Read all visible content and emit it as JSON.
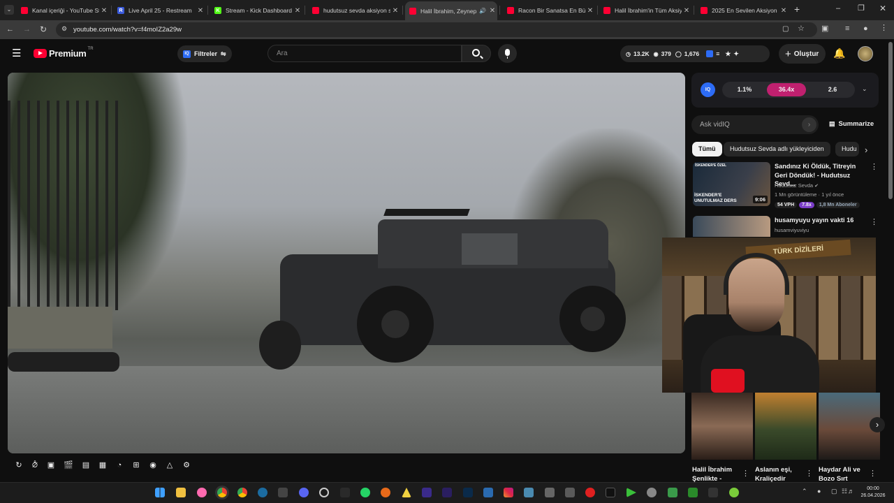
{
  "browser": {
    "tabs": [
      {
        "title": "Kanal içeriği - YouTube St",
        "fav_color": "#ff0033",
        "fav": "",
        "active": false
      },
      {
        "title": "Live April 25 - Restream",
        "fav_color": "#3b5bdb",
        "fav": "R",
        "active": false
      },
      {
        "title": "Stream - Kick Dashboard",
        "fav_color": "#53fc18",
        "fav": "K",
        "active": false
      },
      {
        "title": "hudutsuz sevda aksiyon s",
        "fav_color": "#ff0033",
        "fav": "",
        "active": false
      },
      {
        "title": "Halil İbrahim, Zeynep",
        "fav_color": "#ff0033",
        "fav": "",
        "active": true
      },
      {
        "title": "Racon Bir Sanatsa En Büy",
        "fav_color": "#ff0033",
        "fav": "",
        "active": false
      },
      {
        "title": "Halil İbrahim'in Tüm Aksiy",
        "fav_color": "#ff0033",
        "fav": "",
        "active": false
      },
      {
        "title": "2025 En Sevilen Aksiyon",
        "fav_color": "#ff0033",
        "fav": "",
        "active": false
      }
    ],
    "new_tab": "+",
    "url": "youtube.com/watch?v=f4moIZ2a29w"
  },
  "youtube": {
    "logo_text": "Premium",
    "logo_badge": "TR",
    "filters_label": "Filtreler",
    "search_placeholder": "Ara",
    "stats": {
      "a": "13.2K",
      "b": "379",
      "c": "1,676"
    },
    "create_label": "Oluştur"
  },
  "vidiq": {
    "logo": "IQ",
    "metric1": "1.1%",
    "metric2": "36.4x",
    "metric3": "2.6",
    "ask_placeholder": "Ask vidIQ",
    "summarize": "Summarize"
  },
  "chips": [
    "Tümü",
    "Hudutsuz Sevda adlı yükleyiciden",
    "Hudu"
  ],
  "recommendations": [
    {
      "title": "Sandınız Ki Öldük, Titreyin Geri Döndük! - Hudutsuz Sevd...",
      "channel": "Hudutsuz Sevda",
      "meta": "1 Mn görüntüleme · 1 yıl önce",
      "duration": "9:06",
      "thumb_text": "İSKENDER'E UNUTULMAZ DERS",
      "thumb_top": "İSKENDER'E ÖZEL",
      "vph": "54 VPH",
      "ratio": "7.8x",
      "subs": "1,8 Mn Aboneler"
    },
    {
      "title": "husamyuyu yayın vakti 16",
      "channel": "husamviyuviyu"
    }
  ],
  "shorts": [
    {
      "title": "Halil İbrahim Şenlikte -"
    },
    {
      "title": "Aslanın eşi, Kraliçedir"
    },
    {
      "title": "Haydar Ali ve Bozo Sırt"
    }
  ],
  "webcam_text": "TÜRK DİZİLERİ",
  "taskbar": {
    "time": "00:00",
    "date": "26.04.2026"
  }
}
